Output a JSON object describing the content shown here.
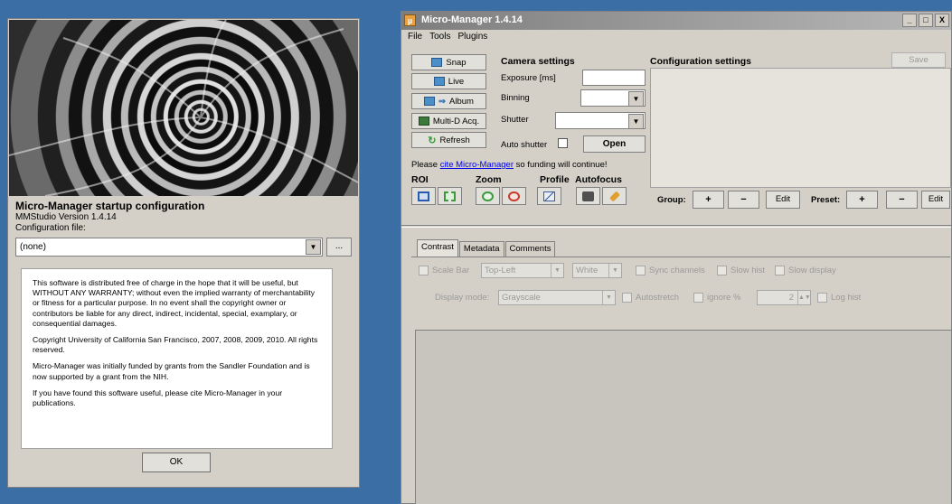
{
  "startup": {
    "title": "Micro-Manager startup configuration",
    "version": "MMStudio Version 1.4.14",
    "config_label": "Configuration file:",
    "config_value": "(none)",
    "browse_label": "...",
    "license": [
      "This software is distributed free of charge in the hope that it will be useful, but WITHOUT ANY WARRANTY; without even the implied warranty of merchantability or fitness for a particular purpose. In no event shall the copyright owner or contributors be liable for any direct, indirect, incidental, special, examplary, or consequential damages.",
      "Copyright University of California San Francisco, 2007, 2008, 2009, 2010. All rights reserved.",
      "Micro-Manager was initially funded by grants from the Sandler Foundation and is now supported by a grant from the NIH.",
      "If you have found this software useful, please cite Micro-Manager in your publications."
    ],
    "ok_label": "OK"
  },
  "main": {
    "title": "Micro-Manager 1.4.14",
    "window_controls": [
      "_",
      "□",
      "X"
    ],
    "menu": [
      "File",
      "Tools",
      "Plugins"
    ],
    "buttons": {
      "snap": "Snap",
      "live": "Live",
      "album": "Album",
      "multid": "Multi-D Acq.",
      "refresh": "Refresh"
    },
    "camera": {
      "title": "Camera settings",
      "exposure_label": "Exposure [ms]",
      "exposure_value": "",
      "binning_label": "Binning",
      "shutter_label": "Shutter",
      "auto_shutter_label": "Auto shutter",
      "open_label": "Open"
    },
    "cite": {
      "prefix": "Please ",
      "link": "cite Micro-Manager",
      "suffix": " so funding will continue!"
    },
    "sections": {
      "roi": "ROI",
      "zoom": "Zoom",
      "profile": "Profile",
      "autofocus": "Autofocus"
    },
    "config": {
      "title": "Configuration settings",
      "save_label": "Save",
      "group_label": "Group:",
      "preset_label": "Preset:",
      "plus": "+",
      "minus": "−",
      "edit": "Edit"
    },
    "tabs": [
      "Contrast",
      "Metadata",
      "Comments"
    ],
    "contrast": {
      "scale_bar": "Scale Bar",
      "position": "Top-Left",
      "color": "White",
      "sync_channels": "Sync channels",
      "slow_hist": "Slow hist",
      "slow_display": "Slow display",
      "display_mode_label": "Display mode:",
      "display_mode_value": "Grayscale",
      "autostretch": "Autostretch",
      "ignore": "ignore %",
      "ignore_value": "2",
      "log_hist": "Log hist"
    }
  }
}
